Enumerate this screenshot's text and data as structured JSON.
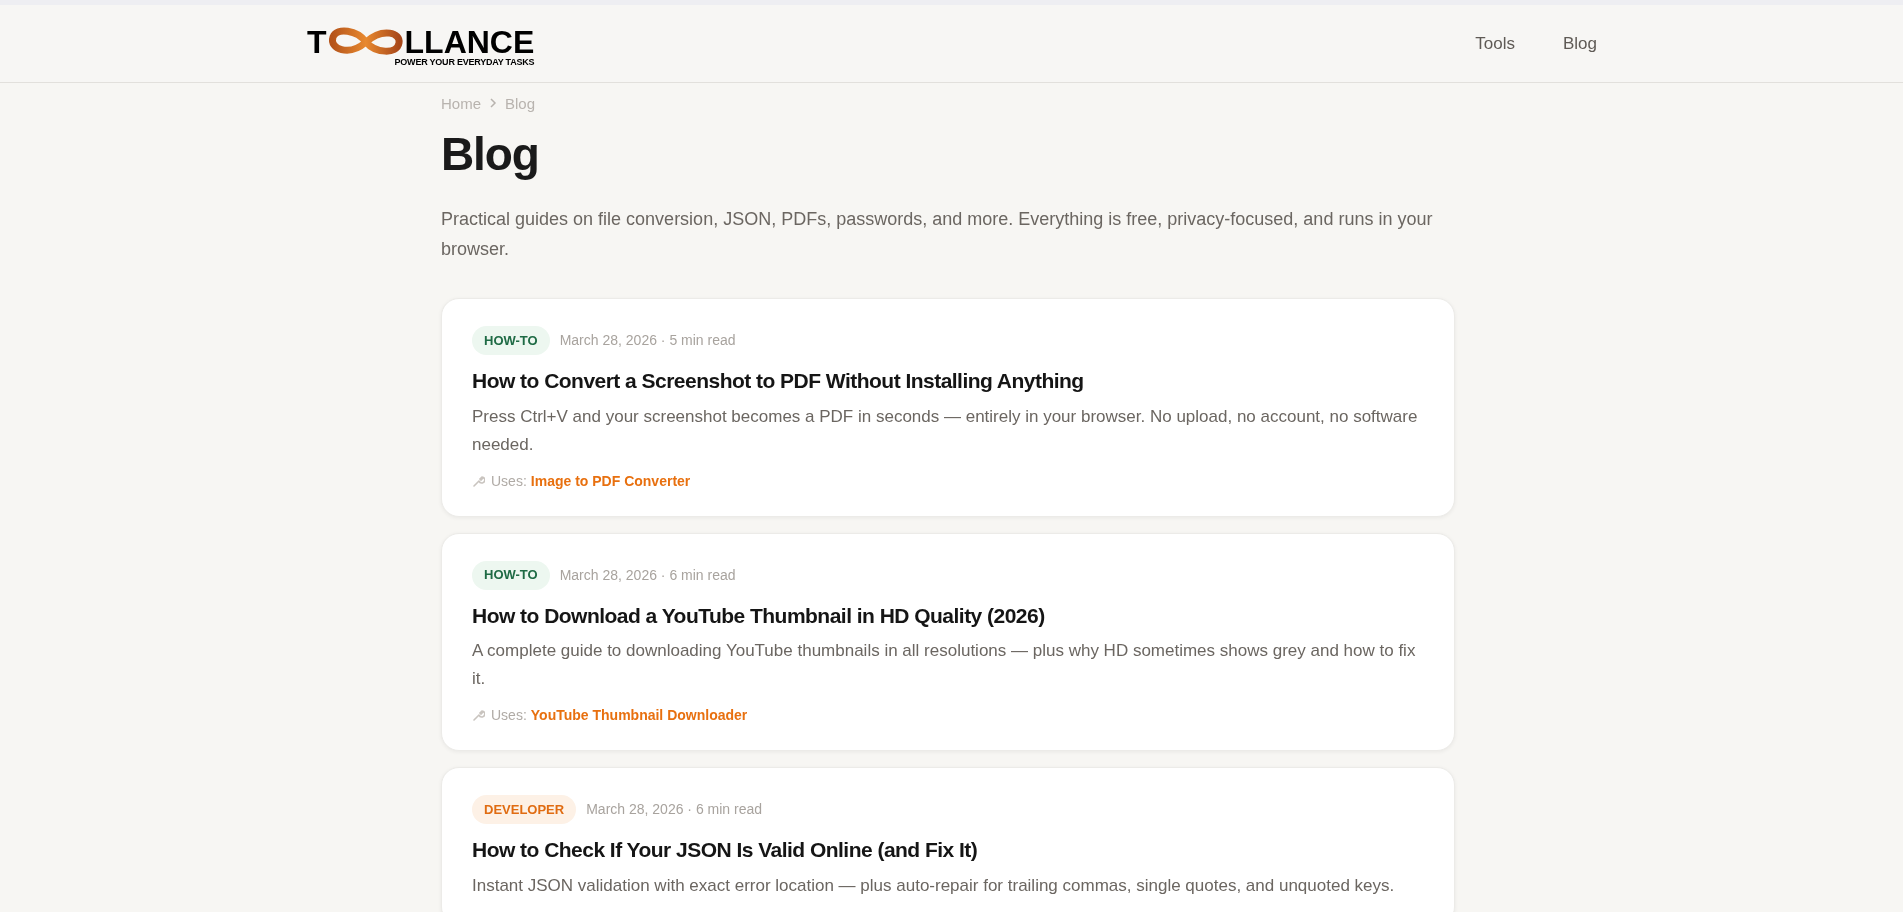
{
  "header": {
    "logo": {
      "start": "T",
      "end": "LLANCE",
      "tagline": "POWER YOUR EVERYDAY TASKS"
    },
    "nav": [
      {
        "label": "Tools"
      },
      {
        "label": "Blog"
      }
    ]
  },
  "breadcrumb": [
    "Home",
    "Blog"
  ],
  "page": {
    "title": "Blog",
    "description": "Practical guides on file conversion, JSON, PDFs, passwords, and more. Everything is free, privacy-focused, and runs in your browser."
  },
  "posts": [
    {
      "category": "HOW-TO",
      "kind": "howto",
      "meta": "March 28, 2026 · 5 min read",
      "title": "How to Convert a Screenshot to PDF Without Installing Anything",
      "summary": "Press Ctrl+V and your screenshot becomes a PDF in seconds — entirely in your browser. No upload, no account, no software needed.",
      "uses_label": "Uses:",
      "tool": "Image to PDF Converter"
    },
    {
      "category": "HOW-TO",
      "kind": "howto",
      "meta": "March 28, 2026 · 6 min read",
      "title": "How to Download a YouTube Thumbnail in HD Quality (2026)",
      "summary": "A complete guide to downloading YouTube thumbnails in all resolutions — plus why HD sometimes shows grey and how to fix it.",
      "uses_label": "Uses:",
      "tool": "YouTube Thumbnail Downloader"
    },
    {
      "category": "DEVELOPER",
      "kind": "developer",
      "meta": "March 28, 2026 · 6 min read",
      "title": "How to Check If Your JSON Is Valid Online (and Fix It)",
      "summary": "Instant JSON validation with exact error location — plus auto-repair for trailing commas, single quotes, and unquoted keys."
    }
  ]
}
